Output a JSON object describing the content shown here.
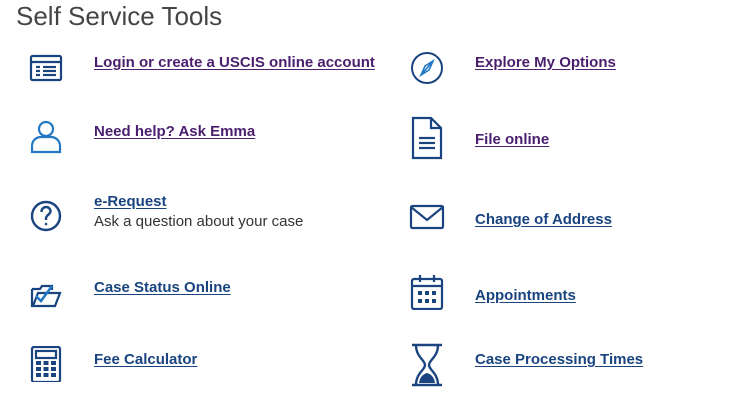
{
  "page": {
    "title": "Self Service Tools"
  },
  "tools": {
    "login": {
      "label": "Login or create a USCIS online account",
      "icon": "browser-window-icon"
    },
    "emma": {
      "label": "Need help?  Ask Emma",
      "icon": "person-icon"
    },
    "erequest": {
      "label": "e-Request",
      "sublabel": "Ask a question about your case",
      "icon": "question-circle-icon"
    },
    "case_status": {
      "label": "Case Status Online",
      "icon": "folder-check-icon"
    },
    "fee": {
      "label": "Fee Calculator",
      "icon": "calculator-icon"
    },
    "explore": {
      "label": "Explore My Options",
      "icon": "compass-icon"
    },
    "file_online": {
      "label": "File online",
      "icon": "document-icon"
    },
    "address": {
      "label": "Change of Address",
      "icon": "envelope-icon"
    },
    "appointments": {
      "label": "Appointments ",
      "icon": "calendar-icon"
    },
    "processing": {
      "label": "Case Processing Times",
      "icon": "hourglass-icon"
    }
  },
  "colors": {
    "icon": "#1a4480",
    "visited_link": "#4a1f6e",
    "link": "#1a4480",
    "title": "#454545"
  }
}
